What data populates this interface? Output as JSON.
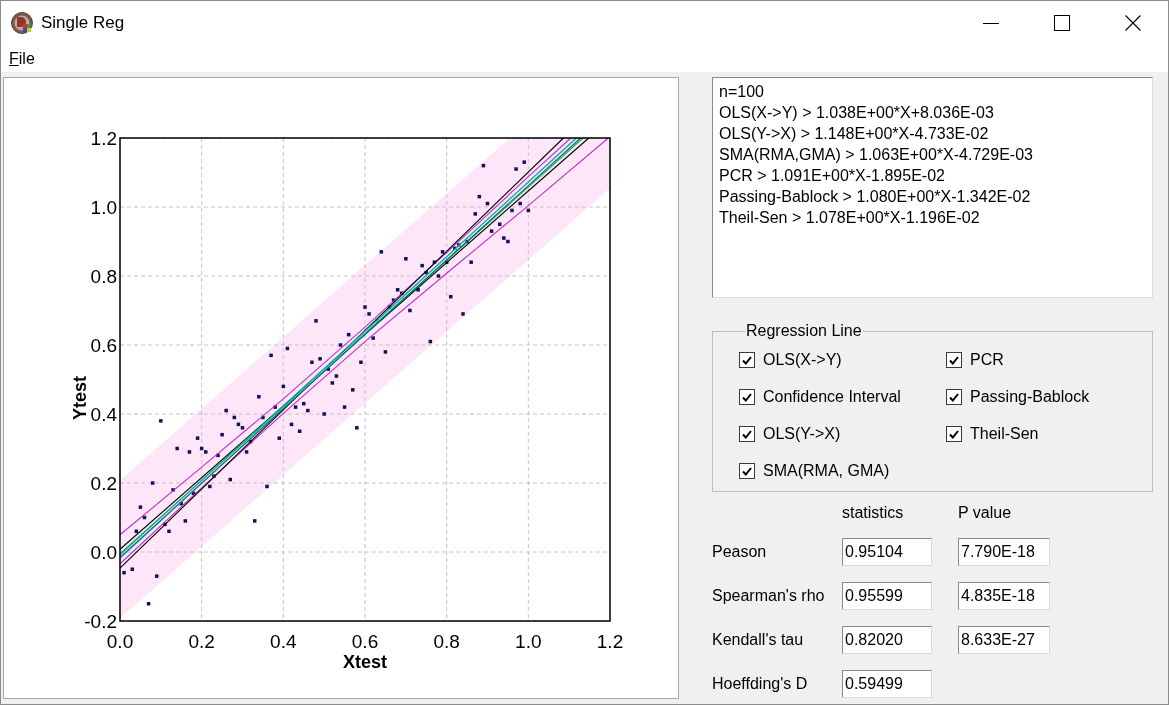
{
  "window": {
    "title": "Single Reg"
  },
  "menu": [
    {
      "label": "File",
      "mnemonic_underlined": true
    }
  ],
  "plot": {
    "chart_data": [
      {
        "type": "scatter",
        "xlabel": "Xtest",
        "ylabel": "Ytest",
        "xlim": [
          0,
          1.2
        ],
        "ylim": [
          -0.2,
          1.2
        ],
        "grid": true,
        "xticks": [
          {
            "value": 0,
            "label": "0.0"
          },
          {
            "value": 0.2,
            "label": "0.2"
          },
          {
            "value": 0.4,
            "label": "0.4"
          },
          {
            "value": 0.6,
            "label": "0.6"
          },
          {
            "value": 0.8,
            "label": "0.8"
          },
          {
            "value": 1,
            "label": "1.0"
          },
          {
            "value": 1.2,
            "label": "1.2"
          }
        ],
        "yticks": [
          {
            "value": -0.2,
            "label": "-0.2"
          },
          {
            "value": 0,
            "label": "0.0"
          },
          {
            "value": 0.2,
            "label": "0.2"
          },
          {
            "value": 0.4,
            "label": "0.4"
          },
          {
            "value": 0.6,
            "label": "0.6"
          },
          {
            "value": 0.8,
            "label": "0.8"
          },
          {
            "value": 1,
            "label": "1.0"
          },
          {
            "value": 1.2,
            "label": "1.2"
          }
        ],
        "series": [
          {
            "type": "area",
            "color": "#fce6f8",
            "x": [
              0,
              0.955,
              1.2,
              1.2,
              0
            ],
            "values": [
              0.208,
              1.2,
              1.2,
              1.054,
              -0.192
            ]
          },
          {
            "type": "scatter",
            "marker": "square",
            "color": "#14105c",
            "x": [
              0.01,
              0.03,
              0.04,
              0.05,
              0.06,
              0.07,
              0.08,
              0.09,
              0.1,
              0.11,
              0.12,
              0.13,
              0.14,
              0.15,
              0.16,
              0.17,
              0.18,
              0.19,
              0.2,
              0.21,
              0.22,
              0.23,
              0.24,
              0.25,
              0.26,
              0.27,
              0.28,
              0.29,
              0.3,
              0.31,
              0.32,
              0.33,
              0.34,
              0.35,
              0.36,
              0.37,
              0.38,
              0.39,
              0.4,
              0.41,
              0.42,
              0.43,
              0.44,
              0.45,
              0.46,
              0.47,
              0.48,
              0.49,
              0.5,
              0.51,
              0.52,
              0.53,
              0.54,
              0.55,
              0.56,
              0.57,
              0.58,
              0.59,
              0.6,
              0.61,
              0.62,
              0.63,
              0.64,
              0.65,
              0.66,
              0.67,
              0.68,
              0.69,
              0.7,
              0.71,
              0.73,
              0.74,
              0.75,
              0.76,
              0.77,
              0.78,
              0.79,
              0.8,
              0.81,
              0.82,
              0.83,
              0.84,
              0.85,
              0.86,
              0.87,
              0.88,
              0.89,
              0.9,
              0.91,
              0.93,
              0.94,
              0.95,
              0.96,
              0.97,
              0.98,
              0.99,
              1.0
            ],
            "values": [
              -0.06,
              -0.05,
              0.06,
              0.13,
              0.1,
              -0.15,
              0.2,
              -0.07,
              0.38,
              0.08,
              0.06,
              0.18,
              0.3,
              0.14,
              0.09,
              0.29,
              0.17,
              0.33,
              0.3,
              0.29,
              0.19,
              0.22,
              0.28,
              0.34,
              0.41,
              0.21,
              0.39,
              0.37,
              0.36,
              0.29,
              0.32,
              0.09,
              0.45,
              0.39,
              0.19,
              0.57,
              0.42,
              0.33,
              0.48,
              0.59,
              0.37,
              0.42,
              0.35,
              0.43,
              0.41,
              0.55,
              0.67,
              0.56,
              0.4,
              0.53,
              0.49,
              0.51,
              0.6,
              0.42,
              0.63,
              0.47,
              0.36,
              0.55,
              0.71,
              0.69,
              0.62,
              0.67,
              0.87,
              0.58,
              0.71,
              0.73,
              0.76,
              0.75,
              0.85,
              0.7,
              0.76,
              0.83,
              0.81,
              0.61,
              0.84,
              0.8,
              0.87,
              0.84,
              0.74,
              0.88,
              0.89,
              0.69,
              0.9,
              0.84,
              0.98,
              1.03,
              1.12,
              1.01,
              0.93,
              0.95,
              0.91,
              0.9,
              0.99,
              1.11,
              1.01,
              1.13,
              0.99
            ]
          },
          {
            "type": "line",
            "color": "#c030c8",
            "x": [
              0,
              0.2,
              0.4,
              0.6,
              0.8,
              1.0,
              1.104
            ],
            "values": [
              0.05,
              0.246,
              0.444,
              0.652,
              0.868,
              1.088,
              1.2
            ]
          },
          {
            "type": "line",
            "color": "#c030c8",
            "x": [
              0,
              0.2,
              0.4,
              0.6,
              0.8,
              1.0,
              1.196
            ],
            "values": [
              -0.034,
              0.186,
              0.402,
              0.61,
              0.808,
              1.004,
              1.2
            ]
          },
          {
            "type": "line",
            "color": "#000000",
            "x": [
              0,
              1.148
            ],
            "values": [
              0.008,
              1.2
            ]
          },
          {
            "type": "line",
            "color": "#000000",
            "x": [
              0,
              1.086
            ],
            "values": [
              -0.047,
              1.2
            ]
          },
          {
            "type": "line",
            "color": "#00c040",
            "x": [
              0,
              1.134
            ],
            "values": [
              -0.005,
              1.2
            ]
          },
          {
            "type": "line",
            "color": "#40e0e0",
            "x": [
              0,
              1.117
            ],
            "values": [
              -0.019,
              1.2
            ]
          },
          {
            "type": "line",
            "color": "#20a0a0",
            "x": [
              0,
              1.118
            ],
            "values": [
              -0.008,
              1.2
            ]
          },
          {
            "type": "line",
            "color": "#006a6a",
            "x": [
              0,
              1.128
            ],
            "values": [
              -0.016,
              1.2
            ]
          }
        ]
      }
    ]
  },
  "results": {
    "lines": [
      "n=100",
      "OLS(X->Y) > 1.038E+00*X+8.036E-03",
      "OLS(Y->X) > 1.148E+00*X-4.733E-02",
      "SMA(RMA,GMA) > 1.063E+00*X-4.729E-03",
      "PCR > 1.091E+00*X-1.895E-02",
      "Passing-Bablock > 1.080E+00*X-1.342E-02",
      "Theil-Sen > 1.078E+00*X-1.196E-02"
    ]
  },
  "regression_line": {
    "title": "Regression Line",
    "options": [
      {
        "label": "OLS(X->Y)",
        "checked": true
      },
      {
        "label": "PCR",
        "checked": true
      },
      {
        "label": "Confidence Interval",
        "checked": true
      },
      {
        "label": "Passing-Bablock",
        "checked": true
      },
      {
        "label": "OLS(Y->X)",
        "checked": true
      },
      {
        "label": "Theil-Sen",
        "checked": true
      },
      {
        "label": "SMA(RMA, GMA)",
        "checked": true
      }
    ]
  },
  "statistics": {
    "column_headers": [
      "statistics",
      "P value"
    ],
    "rows": [
      {
        "label": "Peason",
        "statistic": "0.95104",
        "p_value": "7.790E-18"
      },
      {
        "label": "Spearman's rho",
        "statistic": "0.95599",
        "p_value": "4.835E-18"
      },
      {
        "label": "Kendall's tau",
        "statistic": "0.82020",
        "p_value": "8.633E-27"
      },
      {
        "label": "Hoeffding's D",
        "statistic": "0.59499"
      }
    ]
  }
}
